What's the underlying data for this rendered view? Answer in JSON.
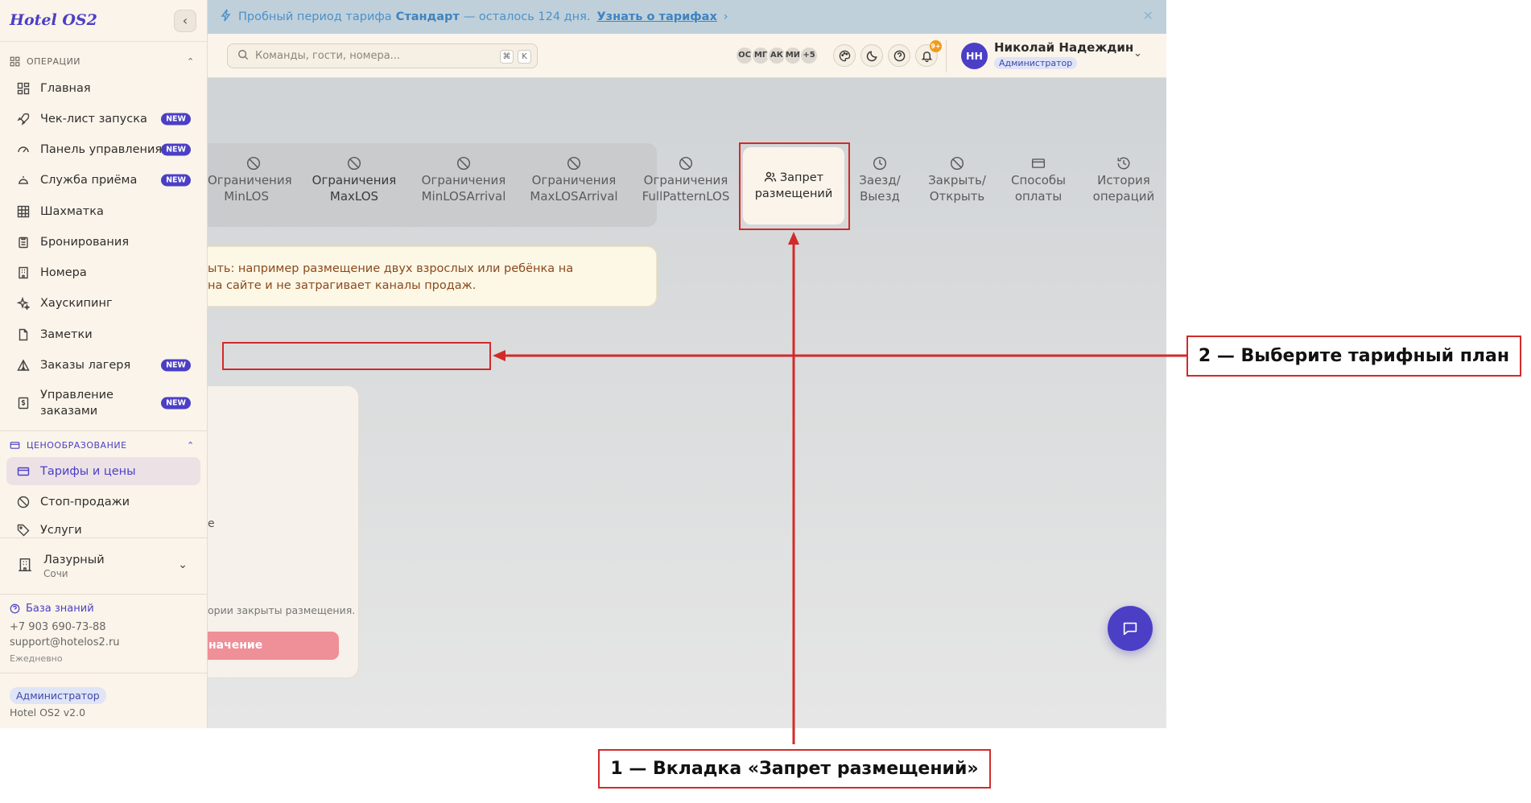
{
  "sidebar": {
    "brand": "Hotel OS2",
    "sections": {
      "operations": "ОПЕРАЦИИ",
      "pricing": "ЦЕНООБРАЗОВАНИЕ"
    },
    "items": [
      {
        "label": "Главная",
        "icon": "grid-icon",
        "badge": ""
      },
      {
        "label": "Чек-лист запуска",
        "icon": "rocket-icon",
        "badge": "NEW"
      },
      {
        "label": "Панель управления",
        "icon": "gauge-icon",
        "badge": "NEW"
      },
      {
        "label": "Служба приёма",
        "icon": "bell-desk-icon",
        "badge": "NEW"
      },
      {
        "label": "Шахматка",
        "icon": "table-grid-icon",
        "badge": ""
      },
      {
        "label": "Бронирования",
        "icon": "clipboard-icon",
        "badge": ""
      },
      {
        "label": "Номера",
        "icon": "building-icon",
        "badge": ""
      },
      {
        "label": "Хаускипинг",
        "icon": "sparkles-icon",
        "badge": ""
      },
      {
        "label": "Заметки",
        "icon": "file-icon",
        "badge": ""
      },
      {
        "label": "Заказы лагеря",
        "icon": "tent-icon",
        "badge": "NEW"
      },
      {
        "label": "Управление заказами",
        "icon": "dollar-doc-icon",
        "badge": "NEW"
      }
    ],
    "pricing_items": [
      {
        "label": "Тарифы и цены",
        "icon": "card-icon"
      },
      {
        "label": "Стоп-продажи",
        "icon": "ban-icon"
      },
      {
        "label": "Услуги",
        "icon": "tag-icon"
      }
    ],
    "hotel": {
      "name": "Лазурный",
      "city": "Сочи"
    },
    "knowledge_base": "База знаний",
    "phone": "+7 903 690-73-88",
    "email": "support@hotelos2.ru",
    "schedule": "Ежедневно",
    "role": "Администратор",
    "version": "Hotel OS2 v2.0"
  },
  "banner": {
    "text_before": "Пробный период тарифа",
    "plan": "Стандарт",
    "text_after": "— осталось 124 дня.",
    "link": "Узнать о тарифах"
  },
  "header": {
    "search_placeholder": "Команды, гости, номера...",
    "kbd_cmd": "⌘",
    "kbd_key": "K",
    "avatars": [
      "ОС",
      "МГ",
      "АК",
      "МИ",
      "+5"
    ],
    "notif_count": "9+",
    "user_initials": "НН",
    "user_name": "Николай Надеждин",
    "user_role": "Администратор"
  },
  "tabs": [
    {
      "label_1": "Ограничения",
      "label_2": "MinLOS"
    },
    {
      "label_1": "Ограничения",
      "label_2": "MaxLOS"
    },
    {
      "label_1": "Ограничения",
      "label_2": "MinLOSArrival"
    },
    {
      "label_1": "Ограничения",
      "label_2": "MaxLOSArrival"
    },
    {
      "label_1": "Ограничения",
      "label_2": "FullPatternLOS"
    },
    {
      "label_1": "Запрет",
      "label_2": "размещений"
    },
    {
      "label_1": "Заезд/",
      "label_2": "Выезд"
    },
    {
      "label_1": "Закрыть/",
      "label_2": "Открыть"
    },
    {
      "label_1": "Способы",
      "label_2": "оплаты"
    },
    {
      "label_1": "История",
      "label_2": "операций"
    }
  ],
  "info": {
    "line1": "ыть: например размещение двух взрослых или ребёнка на",
    "line2": "на сайте и не затрагивает каналы продаж."
  },
  "panel": {
    "letter": "е",
    "text": "ории закрыты размещения.",
    "button": "начение"
  },
  "annotations": {
    "step1": "1 — Вкладка «Запрет размещений»",
    "step2": "2 — Выберите тарифный план"
  }
}
